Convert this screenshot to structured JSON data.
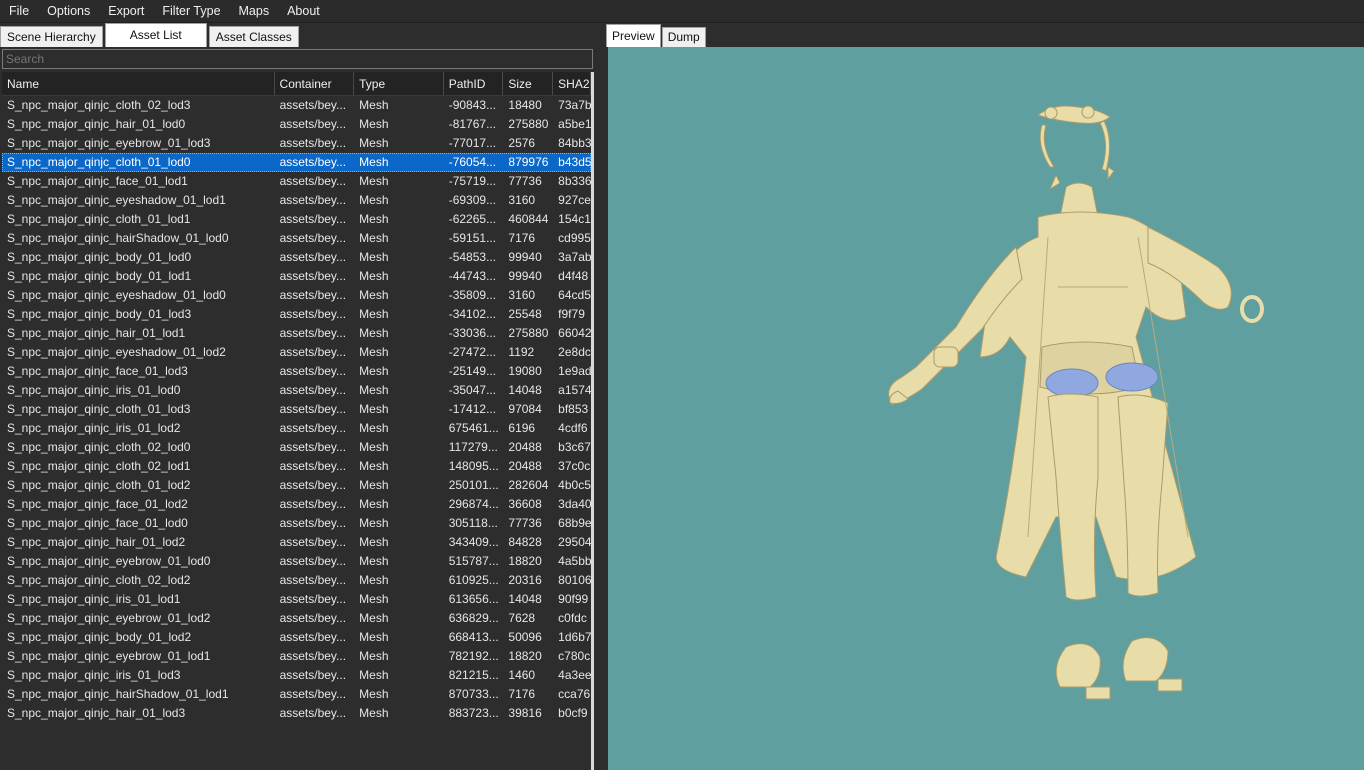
{
  "menu": [
    "File",
    "Options",
    "Export",
    "Filter Type",
    "Maps",
    "About"
  ],
  "left_tabs": [
    {
      "label": "Scene Hierarchy",
      "active": false
    },
    {
      "label": "Asset List",
      "active": true
    },
    {
      "label": "Asset Classes",
      "active": false
    }
  ],
  "search": {
    "placeholder": "Search",
    "value": ""
  },
  "columns": [
    "Name",
    "Container",
    "Type",
    "PathID",
    "Size",
    "SHA2"
  ],
  "rows": [
    [
      "S_npc_major_qinjc_cloth_02_lod3",
      "assets/bey...",
      "Mesh",
      "-90843...",
      "18480",
      "73a7b"
    ],
    [
      "S_npc_major_qinjc_hair_01_lod0",
      "assets/bey...",
      "Mesh",
      "-81767...",
      "275880",
      "a5be1"
    ],
    [
      "S_npc_major_qinjc_eyebrow_01_lod3",
      "assets/bey...",
      "Mesh",
      "-77017...",
      "2576",
      "84bb3"
    ],
    [
      "S_npc_major_qinjc_cloth_01_lod0",
      "assets/bey...",
      "Mesh",
      "-76054...",
      "879976",
      "b43d5"
    ],
    [
      "S_npc_major_qinjc_face_01_lod1",
      "assets/bey...",
      "Mesh",
      "-75719...",
      "77736",
      "8b336"
    ],
    [
      "S_npc_major_qinjc_eyeshadow_01_lod1",
      "assets/bey...",
      "Mesh",
      "-69309...",
      "3160",
      "927ce"
    ],
    [
      "S_npc_major_qinjc_cloth_01_lod1",
      "assets/bey...",
      "Mesh",
      "-62265...",
      "460844",
      "154c1"
    ],
    [
      "S_npc_major_qinjc_hairShadow_01_lod0",
      "assets/bey...",
      "Mesh",
      "-59151...",
      "7176",
      "cd995"
    ],
    [
      "S_npc_major_qinjc_body_01_lod0",
      "assets/bey...",
      "Mesh",
      "-54853...",
      "99940",
      "3a7ab"
    ],
    [
      "S_npc_major_qinjc_body_01_lod1",
      "assets/bey...",
      "Mesh",
      "-44743...",
      "99940",
      "d4f48"
    ],
    [
      "S_npc_major_qinjc_eyeshadow_01_lod0",
      "assets/bey...",
      "Mesh",
      "-35809...",
      "3160",
      "64cd5"
    ],
    [
      "S_npc_major_qinjc_body_01_lod3",
      "assets/bey...",
      "Mesh",
      "-34102...",
      "25548",
      "f9f79"
    ],
    [
      "S_npc_major_qinjc_hair_01_lod1",
      "assets/bey...",
      "Mesh",
      "-33036...",
      "275880",
      "66042"
    ],
    [
      "S_npc_major_qinjc_eyeshadow_01_lod2",
      "assets/bey...",
      "Mesh",
      "-27472...",
      "1192",
      "2e8dc"
    ],
    [
      "S_npc_major_qinjc_face_01_lod3",
      "assets/bey...",
      "Mesh",
      "-25149...",
      "19080",
      "1e9ad"
    ],
    [
      "S_npc_major_qinjc_iris_01_lod0",
      "assets/bey...",
      "Mesh",
      "-35047...",
      "14048",
      "a1574"
    ],
    [
      "S_npc_major_qinjc_cloth_01_lod3",
      "assets/bey...",
      "Mesh",
      "-17412...",
      "97084",
      "bf853"
    ],
    [
      "S_npc_major_qinjc_iris_01_lod2",
      "assets/bey...",
      "Mesh",
      "675461...",
      "6196",
      "4cdf6"
    ],
    [
      "S_npc_major_qinjc_cloth_02_lod0",
      "assets/bey...",
      "Mesh",
      "117279...",
      "20488",
      "b3c67"
    ],
    [
      "S_npc_major_qinjc_cloth_02_lod1",
      "assets/bey...",
      "Mesh",
      "148095...",
      "20488",
      "37c0c"
    ],
    [
      "S_npc_major_qinjc_cloth_01_lod2",
      "assets/bey...",
      "Mesh",
      "250101...",
      "282604",
      "4b0c5"
    ],
    [
      "S_npc_major_qinjc_face_01_lod2",
      "assets/bey...",
      "Mesh",
      "296874...",
      "36608",
      "3da40"
    ],
    [
      "S_npc_major_qinjc_face_01_lod0",
      "assets/bey...",
      "Mesh",
      "305118...",
      "77736",
      "68b9e"
    ],
    [
      "S_npc_major_qinjc_hair_01_lod2",
      "assets/bey...",
      "Mesh",
      "343409...",
      "84828",
      "29504"
    ],
    [
      "S_npc_major_qinjc_eyebrow_01_lod0",
      "assets/bey...",
      "Mesh",
      "515787...",
      "18820",
      "4a5bb"
    ],
    [
      "S_npc_major_qinjc_cloth_02_lod2",
      "assets/bey...",
      "Mesh",
      "610925...",
      "20316",
      "80106"
    ],
    [
      "S_npc_major_qinjc_iris_01_lod1",
      "assets/bey...",
      "Mesh",
      "613656...",
      "14048",
      "90f99"
    ],
    [
      "S_npc_major_qinjc_eyebrow_01_lod2",
      "assets/bey...",
      "Mesh",
      "636829...",
      "7628",
      "c0fdc"
    ],
    [
      "S_npc_major_qinjc_body_01_lod2",
      "assets/bey...",
      "Mesh",
      "668413...",
      "50096",
      "1d6b7"
    ],
    [
      "S_npc_major_qinjc_eyebrow_01_lod1",
      "assets/bey...",
      "Mesh",
      "782192...",
      "18820",
      "c780c"
    ],
    [
      "S_npc_major_qinjc_iris_01_lod3",
      "assets/bey...",
      "Mesh",
      "821215...",
      "1460",
      "4a3ee"
    ],
    [
      "S_npc_major_qinjc_hairShadow_01_lod1",
      "assets/bey...",
      "Mesh",
      "870733...",
      "7176",
      "cca76"
    ],
    [
      "S_npc_major_qinjc_hair_01_lod3",
      "assets/bey...",
      "Mesh",
      "883723...",
      "39816",
      "b0cf9"
    ]
  ],
  "selected_row": 3,
  "right_tabs": [
    {
      "label": "Preview",
      "active": true
    },
    {
      "label": "Dump",
      "active": false
    }
  ],
  "colors": {
    "viewport_bg": "#5f9f9f",
    "model": "#e8dca8",
    "model_shade": "#b8ab7a",
    "lens": "#8fa8e0",
    "selection": "#0b67c8"
  }
}
